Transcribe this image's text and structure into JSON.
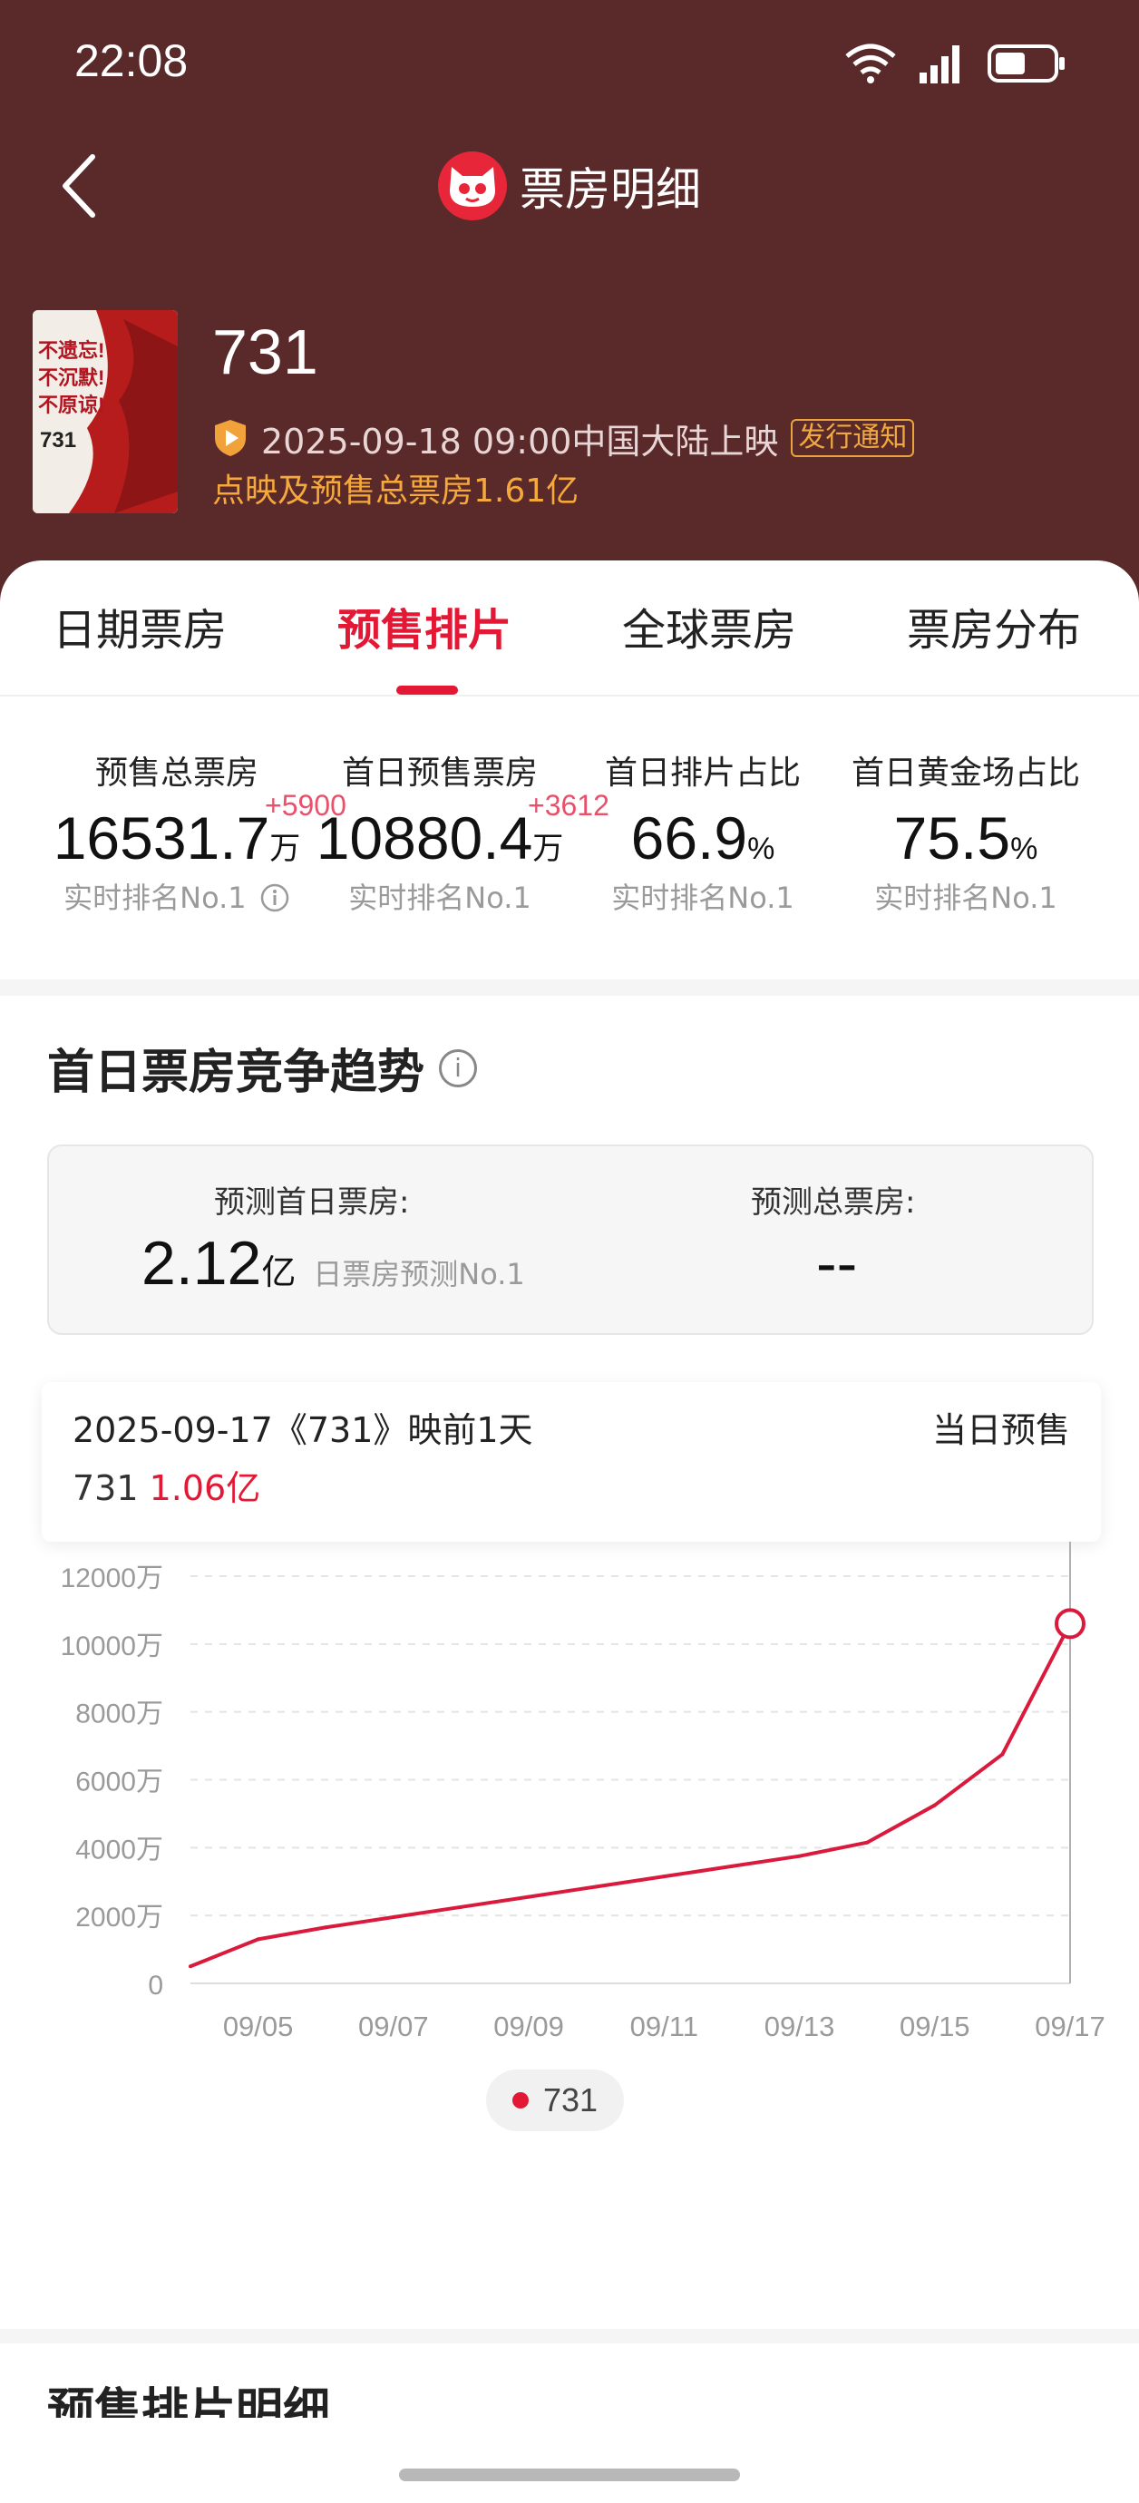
{
  "status_bar": {
    "time": "22:08"
  },
  "nav": {
    "title": "票房明细"
  },
  "movie": {
    "title": "731",
    "release": "2025-09-18 09:00中国大陆上映",
    "notify_tag": "发行通知",
    "presale_total": "点映及预售总票房1.61亿",
    "poster_lines": [
      "不遗忘!",
      "不沉默!",
      "不原谅!"
    ],
    "poster_number": "731"
  },
  "tabs": [
    "日期票房",
    "预售排片",
    "全球票房",
    "票房分布"
  ],
  "active_tab": "预售排片",
  "stats": [
    {
      "label": "预售总票房",
      "value": "16531.7",
      "unit": "万",
      "delta": "+5900",
      "rank": "实时排名No.1"
    },
    {
      "label": "首日预售票房",
      "value": "10880.4",
      "unit": "万",
      "delta": "+3612",
      "rank": "实时排名No.1"
    },
    {
      "label": "首日排片占比",
      "value": "66.9",
      "unit": "%",
      "rank": "实时排名No.1"
    },
    {
      "label": "首日黄金场占比",
      "value": "75.5",
      "unit": "%",
      "rank": "实时排名No.1"
    }
  ],
  "section": {
    "title": "首日票房竞争趋势"
  },
  "prediction": {
    "first_day_label": "预测首日票房:",
    "first_day_value": "2.12",
    "first_day_unit": "亿",
    "first_day_rank": "日票房预测No.1",
    "total_label": "预测总票房:",
    "total_value": "--"
  },
  "tooltip": {
    "date": "2025-09-17《731》映前1天",
    "kind": "当日预售",
    "series": "731",
    "value": "1.06亿"
  },
  "chart_data": {
    "type": "line",
    "x": [
      "09/04",
      "09/05",
      "09/06",
      "09/07",
      "09/08",
      "09/09",
      "09/10",
      "09/11",
      "09/12",
      "09/13",
      "09/14",
      "09/15",
      "09/16",
      "09/17"
    ],
    "x_tick_labels": [
      "09/05",
      "09/07",
      "09/09",
      "09/11",
      "09/13",
      "09/15",
      "09/17"
    ],
    "series": [
      {
        "name": "731",
        "values": [
          500,
          1300,
          1650,
          1950,
          2250,
          2550,
          2850,
          3150,
          3450,
          3750,
          4150,
          5250,
          6750,
          10600
        ]
      }
    ],
    "y_ticks": [
      "0",
      "2000万",
      "4000万",
      "6000万",
      "8000万",
      "10000万",
      "12000万"
    ],
    "ylim": [
      0,
      12000
    ],
    "highlight_index": 13,
    "grid": true,
    "legend": "bottom-center",
    "color": "#d91a3c"
  },
  "next_section": {
    "title": "预售排片明细"
  }
}
